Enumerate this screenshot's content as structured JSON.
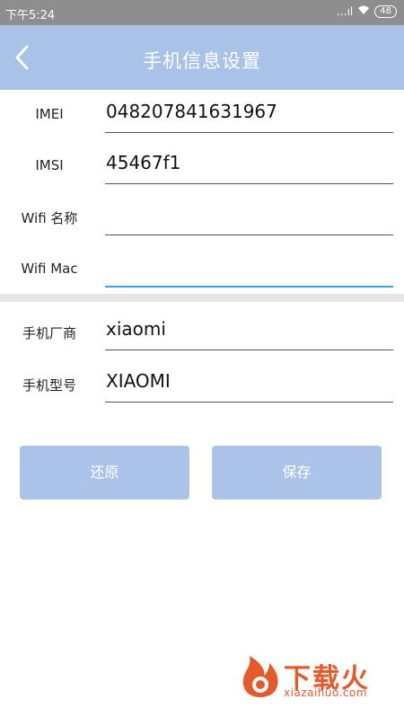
{
  "statusbar": {
    "time": "下午5:24",
    "signal": "...ıl",
    "battery": "48"
  },
  "header": {
    "title": "手机信息设置"
  },
  "fields": [
    {
      "label": "IMEI",
      "value": "048207841631967"
    },
    {
      "label": "IMSI",
      "value": "45467f1"
    },
    {
      "label": "Wifi 名称",
      "value": ""
    },
    {
      "label": "Wifi Mac",
      "value": ""
    },
    {
      "label": "手机厂商",
      "value": "xiaomi"
    },
    {
      "label": "手机型号",
      "value": "XIAOMI"
    }
  ],
  "buttons": {
    "restore": "还原",
    "save": "保存"
  },
  "watermark": {
    "brand": "下载火",
    "url": "xiazaihuo.com"
  },
  "colors": {
    "header_bg": "#a9c2e7",
    "button_bg": "#abc3e8",
    "active_line": "#36a6df",
    "brand": "#e55a2a"
  }
}
